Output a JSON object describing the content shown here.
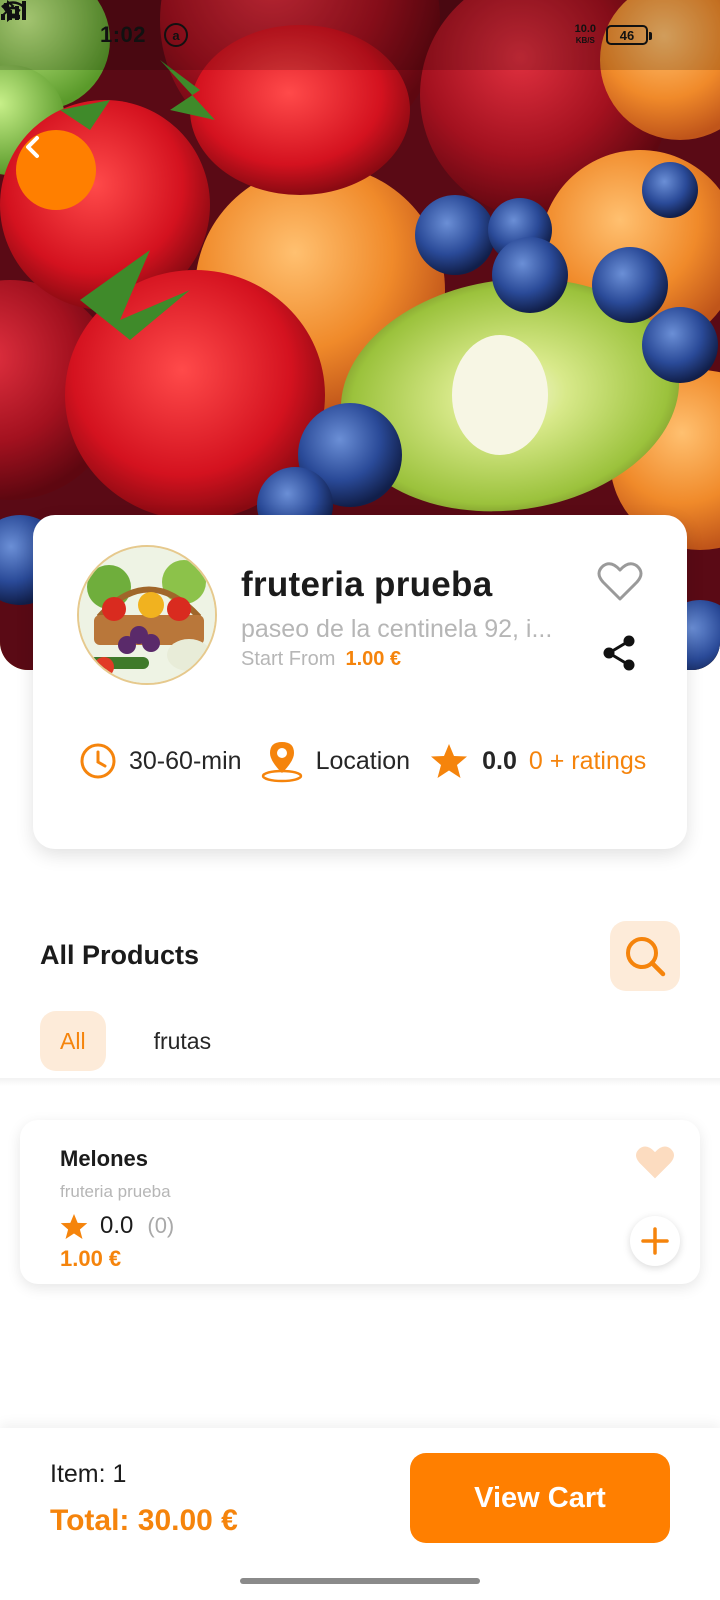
{
  "status_bar": {
    "time": "1:02",
    "alert_glyph": "a",
    "net_speed_value": "10.0",
    "net_speed_unit": "KB/S",
    "battery": "46"
  },
  "colors": {
    "accent": "#ff7f00",
    "accent_light": "#fdebd9",
    "price": "#f5840c",
    "muted_text": "#b6b6b6"
  },
  "icons": {
    "back": "chevron-left-icon",
    "favorite": "heart-icon",
    "share": "share-icon",
    "time": "clock-icon",
    "location": "map-pin-icon",
    "rating": "star-icon",
    "search": "search-icon",
    "add": "plus-icon"
  },
  "store": {
    "name": "fruteria prueba",
    "address": "paseo de la centinela 92, i...",
    "start_label": "Start From",
    "start_price": "1.00 €",
    "delivery_time": "30-60-min",
    "location_label": "Location",
    "rating": "0.0",
    "ratings_count": "0 + ratings"
  },
  "products_section": {
    "title": "All Products",
    "filters": [
      "All",
      "frutas"
    ],
    "active_filter": "All"
  },
  "products": [
    {
      "name": "Melones",
      "store": "fruteria prueba",
      "rating": "0.0",
      "rating_count": "(0)",
      "price": "1.00 €"
    }
  ],
  "cart": {
    "items_label": "Item: 1",
    "total_label": "Total: 30.00 €",
    "button_label": "View Cart"
  }
}
